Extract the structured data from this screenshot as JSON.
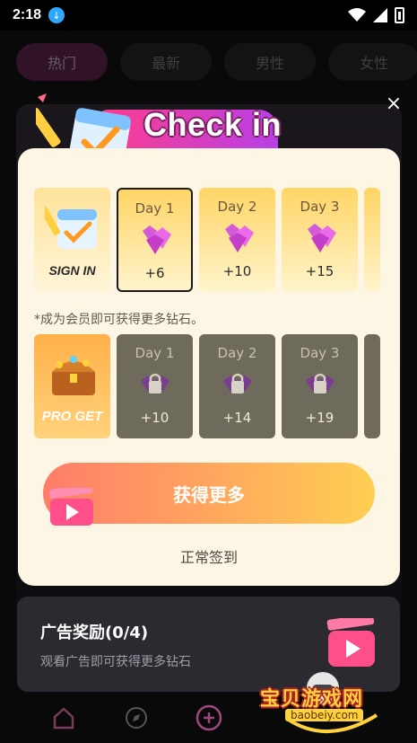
{
  "status_bar": {
    "time": "2:18"
  },
  "background": {
    "tabs": [
      "热门",
      "最新",
      "男性",
      "女性"
    ],
    "ad_panel": {
      "title": "广告奖励(0/4)",
      "subtitle": "观看广告即可获得更多钻石"
    }
  },
  "dialog": {
    "title": "Check in",
    "close_label": "×",
    "signin_badge": "SIGN IN",
    "pro_badge": "PRO GET",
    "free_days": [
      {
        "label": "Day 1",
        "reward": "+6",
        "current": true
      },
      {
        "label": "Day 2",
        "reward": "+10",
        "current": false
      },
      {
        "label": "Day 3",
        "reward": "+15",
        "current": false
      }
    ],
    "member_note": "*成为会员即可获得更多钻石。",
    "pro_days": [
      {
        "label": "Day 1",
        "reward": "+10"
      },
      {
        "label": "Day 2",
        "reward": "+14"
      },
      {
        "label": "Day 3",
        "reward": "+19"
      }
    ],
    "get_more_button": "获得更多",
    "normal_signin_link": "正常签到"
  },
  "watermark": {
    "text": "宝贝游戏网",
    "url": "baobeiy.com"
  },
  "colors": {
    "accent_pink": "#ff3d8e",
    "dialog_bg": "#fdf6e4",
    "button_start": "#ff7d6a",
    "button_end": "#ffcf52"
  },
  "icons": [
    "download-icon",
    "wifi-icon",
    "signal-icon",
    "battery-icon",
    "diamond-icon",
    "lock-icon",
    "clapperboard-icon",
    "treasure-chest-icon",
    "calendar-pencil-icon",
    "home-icon",
    "compass-icon",
    "plus-icon"
  ]
}
